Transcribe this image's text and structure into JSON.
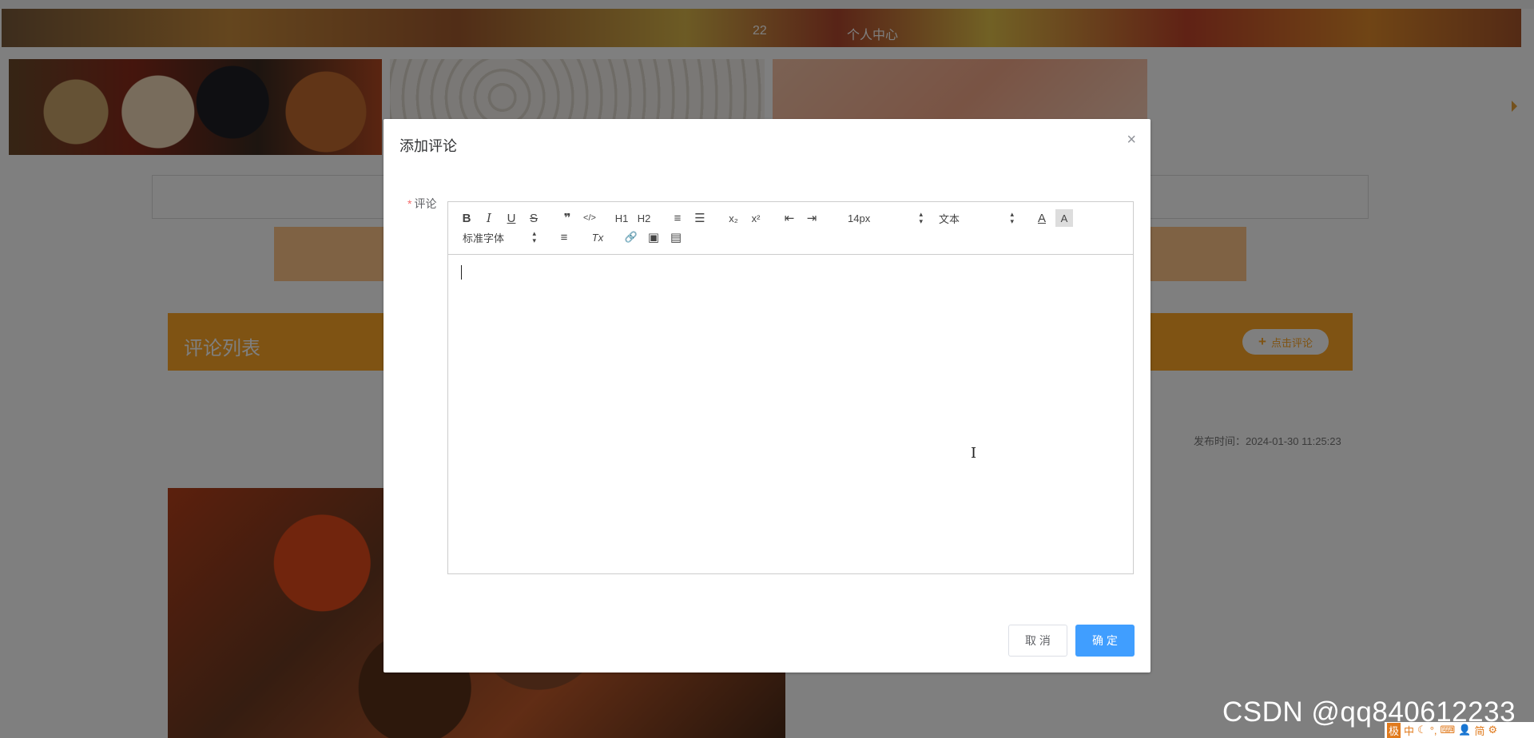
{
  "header": {
    "nav_number": "22",
    "nav_personal_center": "个人中心"
  },
  "comments_section": {
    "title": "评论列表",
    "add_comment_button": "点击评论",
    "publish_time_label": "发布时间：2024-01-30 11:25:23"
  },
  "dialog": {
    "title": "添加评论",
    "close_icon": "×",
    "field_label": "评论",
    "required_mark": "*",
    "toolbar": {
      "bold": "B",
      "italic": "I",
      "underline": "U",
      "strike": "S",
      "blockquote": "❞",
      "code": "</>",
      "h1": "H1",
      "h2": "H2",
      "ordered_list": "≡",
      "bullet_list": "☰",
      "subscript": "x₂",
      "superscript": "x²",
      "outdent": "⇤",
      "indent": "⇥",
      "size_value": "14px",
      "header_value": "文本",
      "color": "A",
      "background": "A",
      "font_value": "标准字体",
      "align": "≡",
      "clean": "Tx",
      "link": "🔗",
      "image": "▣",
      "video": "▤"
    },
    "cancel_button": "取 消",
    "confirm_button": "确 定"
  },
  "watermark": "CSDN @qq840612233",
  "ime_toolbar": {
    "items": [
      "极",
      "中",
      "☾",
      "°,",
      "⌨",
      "👤",
      "简",
      "⚙"
    ]
  },
  "colors": {
    "accent_orange": "#ffa726",
    "primary_blue": "#409eff",
    "required_red": "#f56c6c"
  }
}
